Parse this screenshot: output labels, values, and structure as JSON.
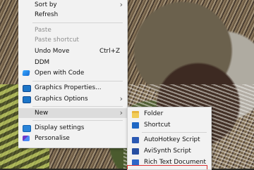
{
  "context_menu": {
    "items": [
      {
        "label": "Sort by"
      },
      {
        "label": "Refresh"
      },
      {
        "label": "Paste"
      },
      {
        "label": "Paste shortcut"
      },
      {
        "label": "Undo Move",
        "shortcut": "Ctrl+Z"
      },
      {
        "label": "DDM"
      },
      {
        "label": "Open with Code",
        "icon": "vs-code-icon"
      },
      {
        "label": "Graphics Properties...",
        "icon": "graphics-properties-icon"
      },
      {
        "label": "Graphics Options",
        "icon": "graphics-options-icon"
      },
      {
        "label": "New"
      },
      {
        "label": "Display settings",
        "icon": "display-settings-icon"
      },
      {
        "label": "Personalise",
        "icon": "personalise-icon"
      }
    ]
  },
  "new_submenu": {
    "items": [
      {
        "label": "Folder",
        "icon": "folder-icon"
      },
      {
        "label": "Shortcut",
        "icon": "shortcut-icon"
      },
      {
        "label": "AutoHotkey Script",
        "icon": "autohotkey-icon"
      },
      {
        "label": "AviSynth Script",
        "icon": "avisynth-icon"
      },
      {
        "label": "Rich Text Document",
        "icon": "rich-text-icon"
      }
    ]
  },
  "colors": {
    "menu_background": "#f2f2f2",
    "highlight": "#dcdcdc",
    "disabled_text": "#8e8e8e",
    "selection_outline": "#dd3333"
  }
}
